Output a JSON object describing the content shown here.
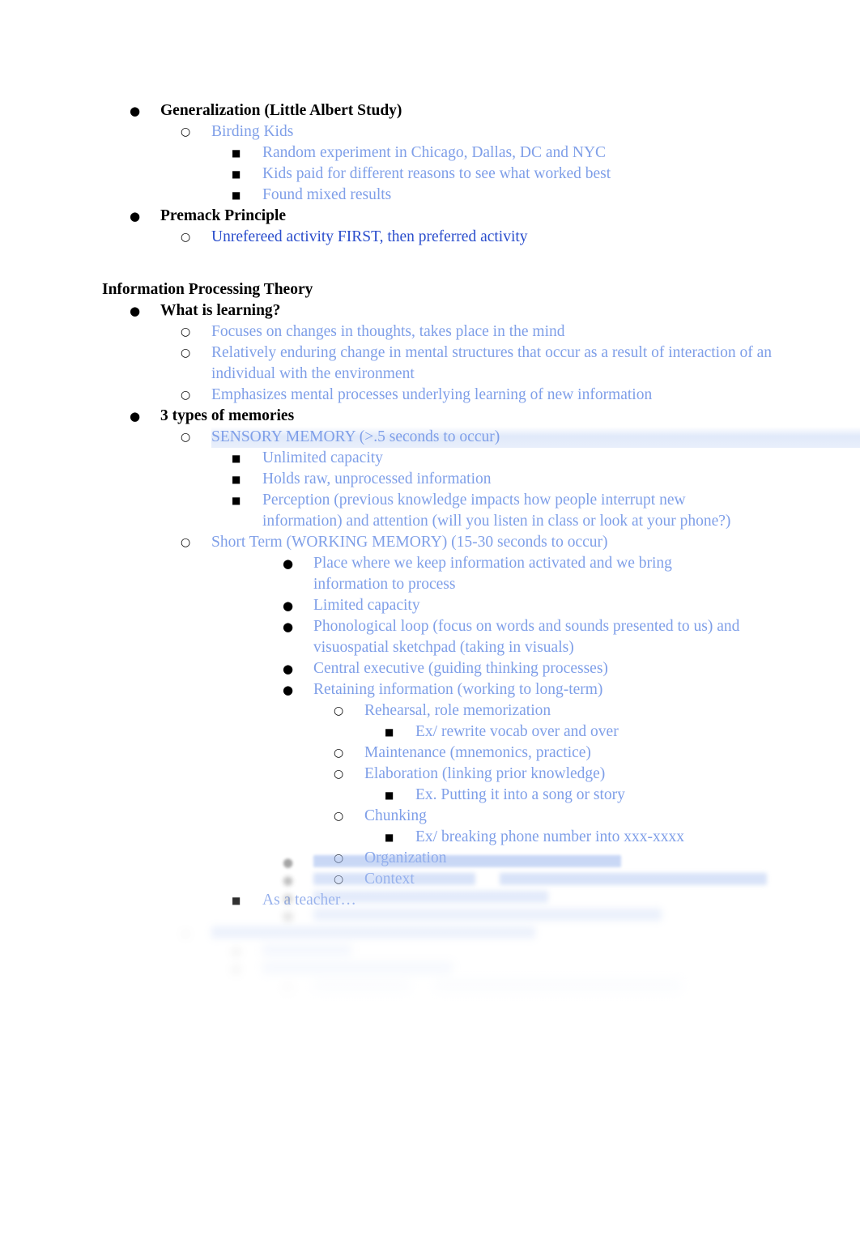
{
  "document": {
    "bullet_glyphs": {
      "disc": "●",
      "circle": "○",
      "square": "■"
    },
    "colors": {
      "body_blue": "#7f9fe8",
      "emphasis_blue": "#2b4ecc",
      "heading_black": "#000000",
      "highlight": "#d6e2f8"
    },
    "blocks": [
      {
        "level": 1,
        "bullet": "disc",
        "text": "Generalization (Little Albert Study)"
      },
      {
        "level": 2,
        "bullet": "circle",
        "text": "Birding Kids"
      },
      {
        "level": 3,
        "bullet": "square",
        "text": "Random experiment in Chicago, Dallas, DC and NYC"
      },
      {
        "level": 3,
        "bullet": "square",
        "text": "Kids paid for different reasons to see what worked best"
      },
      {
        "level": 3,
        "bullet": "square",
        "text": "Found mixed results"
      },
      {
        "level": 1,
        "bullet": "disc",
        "text": "Premack Principle"
      },
      {
        "level": 2,
        "bullet": "circle",
        "text": "Unrefereed activity FIRST, then preferred activity"
      }
    ],
    "section_heading": "Information Processing Theory",
    "ipt_blocks": [
      {
        "level": 1,
        "bullet": "disc",
        "text": "What is learning?"
      },
      {
        "level": 2,
        "bullet": "circle",
        "text": "Focuses on changes in thoughts, takes place in the mind"
      },
      {
        "level": 2,
        "bullet": "circle",
        "text": "Relatively enduring change in mental structures that occur as a result of interaction of an individual with the environment"
      },
      {
        "level": 2,
        "bullet": "circle",
        "text": "Emphasizes mental processes underlying learning of new information"
      },
      {
        "level": 1,
        "bullet": "disc",
        "text": "3 types of memories"
      },
      {
        "level": 2,
        "bullet": "circle",
        "text": "SENSORY MEMORY (>.5 seconds to occur)"
      },
      {
        "level": 3,
        "bullet": "square",
        "text": "Unlimited capacity"
      },
      {
        "level": 3,
        "bullet": "square",
        "text": "Holds raw, unprocessed information"
      },
      {
        "level": 3,
        "bullet": "square",
        "text": "Perception (previous knowledge impacts how people interrupt new information) and attention (will you listen in class or look at your phone?)"
      },
      {
        "level": 2,
        "bullet": "circle",
        "text": "Short Term (WORKING MEMORY) (15-30 seconds to occur)"
      },
      {
        "level": 4,
        "bullet": "disc",
        "text": "Place where we keep information activated and we bring information to process"
      },
      {
        "level": 4,
        "bullet": "disc",
        "text": "Limited capacity"
      },
      {
        "level": 4,
        "bullet": "disc",
        "text": "Phonological loop (focus on words and sounds presented to us) and visuospatial sketchpad (taking in visuals)"
      },
      {
        "level": 4,
        "bullet": "disc",
        "text": "Central executive (guiding thinking processes)"
      },
      {
        "level": 4,
        "bullet": "disc",
        "text": "Retaining information (working to long-term)"
      },
      {
        "level": 5,
        "bullet": "circle",
        "text": "Rehearsal, role memorization"
      },
      {
        "level": 6,
        "bullet": "square",
        "text": "Ex/ rewrite vocab over and over"
      },
      {
        "level": 5,
        "bullet": "circle",
        "text": "Maintenance (mnemonics, practice)"
      },
      {
        "level": 5,
        "bullet": "circle",
        "text": "Elaboration (linking prior knowledge)"
      },
      {
        "level": 6,
        "bullet": "square",
        "text": "Ex. Putting it into a song or story"
      },
      {
        "level": 5,
        "bullet": "circle",
        "text": "Chunking"
      },
      {
        "level": 6,
        "bullet": "square",
        "text": "Ex/ breaking phone number into xxx-xxxx"
      },
      {
        "level": 5,
        "bullet": "circle",
        "text": "Organization"
      },
      {
        "level": 5,
        "bullet": "circle",
        "text": "Context"
      },
      {
        "level": 3,
        "bullet": "square",
        "text": "As a teacher…"
      }
    ],
    "obscured_note": "Remaining outline content below this point is blurred and illegible in the screenshot.",
    "obscured_blocks": [
      {
        "level": 4,
        "bullet": "disc",
        "text": " "
      },
      {
        "level": 4,
        "bullet": "disc",
        "text": " "
      },
      {
        "level": 4,
        "bullet": "disc",
        "text": " "
      },
      {
        "level": 4,
        "bullet": "disc",
        "text": " "
      },
      {
        "level": 2,
        "bullet": "circle",
        "text": " "
      },
      {
        "level": 3,
        "bullet": "square",
        "text": " "
      },
      {
        "level": 3,
        "bullet": "square",
        "text": " "
      },
      {
        "level": 4,
        "bullet": "disc",
        "text": " "
      }
    ]
  }
}
